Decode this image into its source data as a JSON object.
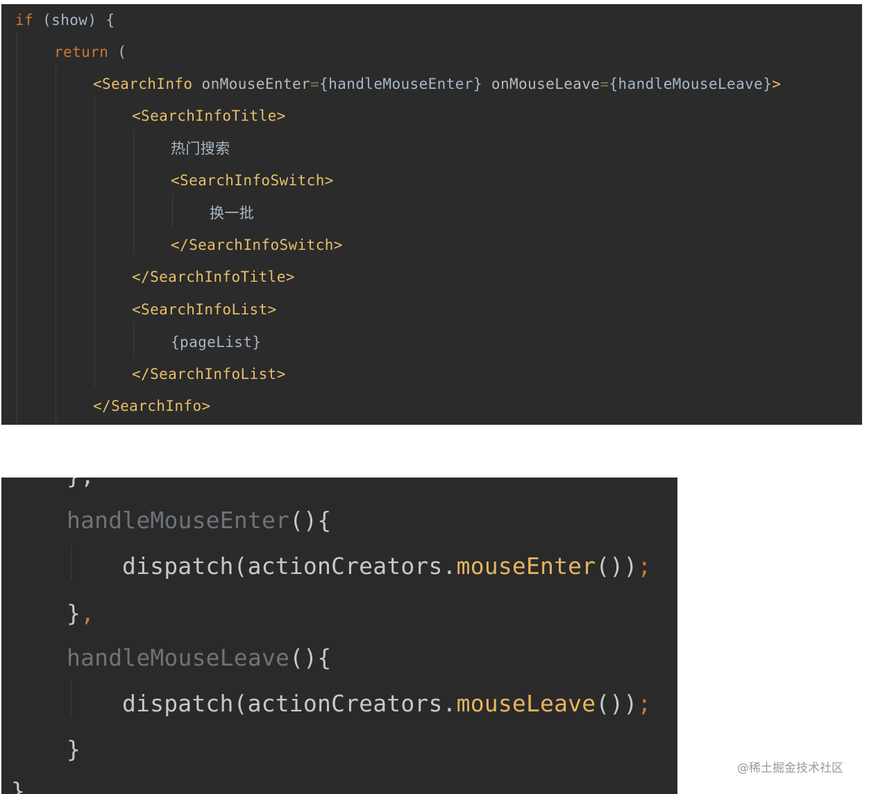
{
  "code_top": {
    "l1": {
      "kw": "if",
      "rest": " (show) {"
    },
    "l2": {
      "kw": "return",
      "rest": " ("
    },
    "l3": {
      "tag_open": "<SearchInfo",
      "attr1": " onMouseEnter",
      "eq1": "=",
      "val1": "{handleMouseEnter}",
      "attr2": " onMouseLeave",
      "eq2": "=",
      "val2": "{handleMouseLeave}",
      "close": ">"
    },
    "l4": "<SearchInfoTitle>",
    "l5": "热门搜索",
    "l6": "<SearchInfoSwitch>",
    "l7": "换一批",
    "l8": "</SearchInfoSwitch>",
    "l9": "</SearchInfoTitle>",
    "l10": "<SearchInfoList>",
    "l11": "{pageList}",
    "l12": "</SearchInfoList>",
    "l13": "</SearchInfo>"
  },
  "code_bottom": {
    "l0": "},",
    "l1": {
      "name": "handleMouseEnter",
      "rest": "(){"
    },
    "l2": {
      "pre": "dispatch(actionCreators.",
      "method": "mouseEnter",
      "post": "())",
      "semi": ";"
    },
    "l3": {
      "brace": "}",
      "comma": ","
    },
    "l4": {
      "name": "handleMouseLeave",
      "rest": "(){"
    },
    "l5": {
      "pre": "dispatch(actionCreators.",
      "method": "mouseLeave",
      "post": "())",
      "semi": ";"
    },
    "l6": "}",
    "l7": "}"
  },
  "watermark": "@稀土掘金技术社区"
}
